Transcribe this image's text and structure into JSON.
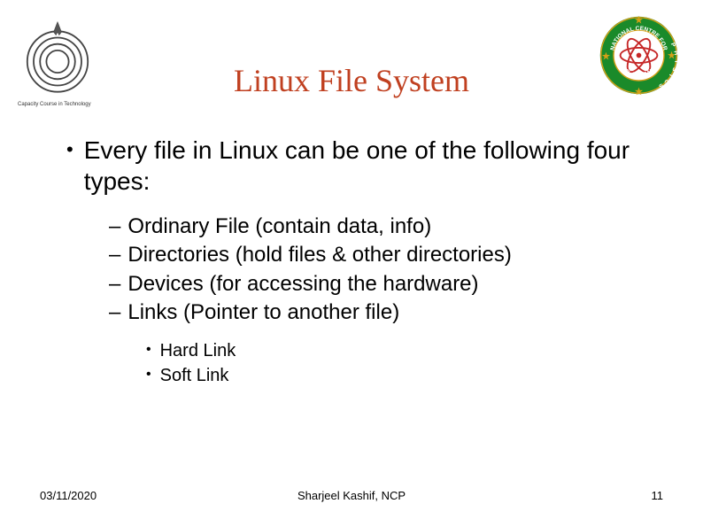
{
  "title": "Linux File System",
  "main_bullet": "Every file in Linux can be one of the following four types:",
  "sub_items": [
    "Ordinary File (contain data, info)",
    "Directories (hold files & other directories)",
    "Devices (for accessing the hardware)",
    "Links (Pointer to another file)"
  ],
  "sub_sub_items": [
    "Hard Link",
    "Soft Link"
  ],
  "footer": {
    "date": "03/11/2020",
    "author": "Sharjeel Kashif, NCP",
    "page": "11"
  },
  "logo_left_caption": "Capacity Course in Technology"
}
